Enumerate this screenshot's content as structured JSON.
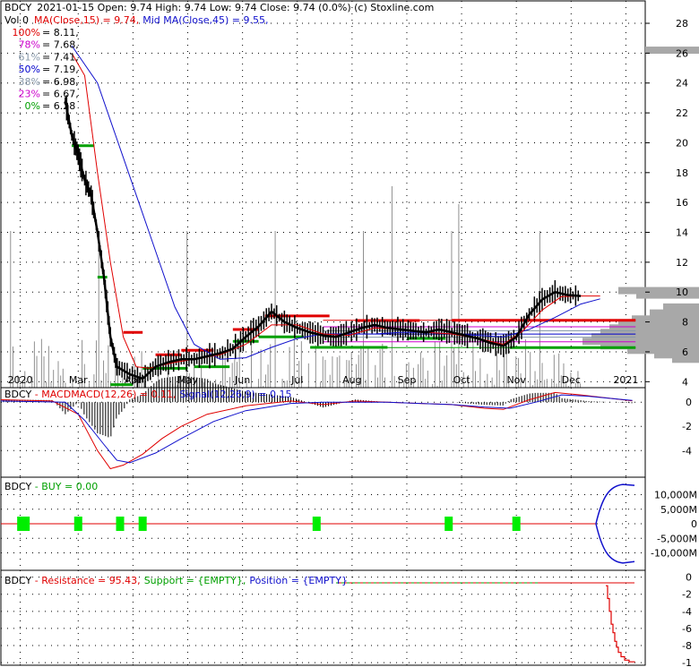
{
  "header": {
    "ticker": "BDCY",
    "quote": "2021-01-15 Open: 9.74  High: 9.74  Low: 9.74  Close: 9.74 (0.0%)  (c) Stoxline.com",
    "vol": "Vol 0",
    "ma": "MA(Close,15) = 9.74,",
    "midma": "Mid MA(Close,45) = 9.55,"
  },
  "fib": [
    {
      "pct": "100%",
      "val": "= 8.11,",
      "color": "#e00000"
    },
    {
      "pct": "78%",
      "val": "= 7.68,",
      "color": "#cc00cc"
    },
    {
      "pct": "61%",
      "val": "= 7.41,",
      "color": "#8899aa"
    },
    {
      "pct": "50%",
      "val": "= 7.19,",
      "color": "#0000cc"
    },
    {
      "pct": "38%",
      "val": "= 6.98,",
      "color": "#8899aa"
    },
    {
      "pct": "23%",
      "val": "= 6.67,",
      "color": "#cc00cc"
    },
    {
      "pct": "0%",
      "val": "= 6.28",
      "color": "#00a000"
    }
  ],
  "panels": {
    "macd": {
      "ticker": "BDCY",
      "name": "MACD",
      "label": "MACD(12,26) = 0.11,",
      "signal": "Signal(12,26,9) = 0.15"
    },
    "buy": {
      "ticker": "BDCY",
      "label": "BUY = 0.00"
    },
    "res": {
      "ticker": "BDCY",
      "resistance": "Resistance = 95.43,",
      "support": "Support = {EMPTY},",
      "position": "Position = {EMPTY}"
    }
  },
  "colors": {
    "red": "#e00000",
    "blue": "#1010cc",
    "green": "#00a000",
    "bright_green": "#00ee00",
    "gray": "#909090"
  },
  "chart_data": [
    {
      "type": "line",
      "title": "BDCY",
      "x_labels": [
        "2020",
        "Mar",
        "Apr",
        "May",
        "Jun",
        "Jul",
        "Aug",
        "Sep",
        "Oct",
        "Nov",
        "Dec",
        "2021"
      ],
      "y_ticks": [
        "4",
        "6",
        "8",
        "10",
        "12",
        "14",
        "16",
        "18",
        "20",
        "22",
        "24",
        "26",
        "28"
      ],
      "ylim": [
        3.3,
        29.5
      ],
      "price": [
        [
          0.1,
          22.8
        ],
        [
          0.11,
          20.5
        ],
        [
          0.12,
          19.2
        ],
        [
          0.13,
          17.5
        ],
        [
          0.14,
          16.5
        ],
        [
          0.15,
          14
        ],
        [
          0.16,
          11
        ],
        [
          0.17,
          7
        ],
        [
          0.18,
          5
        ],
        [
          0.2,
          4.5
        ],
        [
          0.22,
          4.2
        ],
        [
          0.24,
          5
        ],
        [
          0.26,
          5.3
        ],
        [
          0.28,
          5.5
        ],
        [
          0.3,
          5.5
        ],
        [
          0.32,
          5.7
        ],
        [
          0.34,
          5.9
        ],
        [
          0.36,
          6.2
        ],
        [
          0.38,
          7
        ],
        [
          0.4,
          7.7
        ],
        [
          0.42,
          8.7
        ],
        [
          0.44,
          8
        ],
        [
          0.46,
          7.6
        ],
        [
          0.48,
          7.3
        ],
        [
          0.5,
          7.1
        ],
        [
          0.52,
          7
        ],
        [
          0.54,
          7.3
        ],
        [
          0.56,
          7.6
        ],
        [
          0.58,
          7.8
        ],
        [
          0.6,
          7.6
        ],
        [
          0.62,
          7.5
        ],
        [
          0.64,
          7.4
        ],
        [
          0.66,
          7.3
        ],
        [
          0.68,
          7.5
        ],
        [
          0.7,
          7.3
        ],
        [
          0.72,
          7.1
        ],
        [
          0.74,
          6.9
        ],
        [
          0.76,
          6.6
        ],
        [
          0.78,
          6.4
        ],
        [
          0.8,
          7
        ],
        [
          0.82,
          8.5
        ],
        [
          0.84,
          9.5
        ],
        [
          0.86,
          10
        ],
        [
          0.88,
          9.8
        ],
        [
          0.9,
          9.74
        ]
      ],
      "ma15": [
        [
          0.11,
          26
        ],
        [
          0.13,
          24.5
        ],
        [
          0.15,
          18
        ],
        [
          0.17,
          12
        ],
        [
          0.19,
          7
        ],
        [
          0.21,
          5
        ],
        [
          0.23,
          4.9
        ],
        [
          0.27,
          5.3
        ],
        [
          0.3,
          5.5
        ],
        [
          0.34,
          5.8
        ],
        [
          0.38,
          6.5
        ],
        [
          0.42,
          7.8
        ],
        [
          0.46,
          7.8
        ],
        [
          0.5,
          7.2
        ],
        [
          0.54,
          7.1
        ],
        [
          0.58,
          7.6
        ],
        [
          0.62,
          7.5
        ],
        [
          0.66,
          7.3
        ],
        [
          0.7,
          7.2
        ],
        [
          0.74,
          6.9
        ],
        [
          0.78,
          6.5
        ],
        [
          0.81,
          7.4
        ],
        [
          0.84,
          8.8
        ],
        [
          0.87,
          9.7
        ],
        [
          0.9,
          9.74
        ],
        [
          0.93,
          9.74
        ]
      ],
      "ma45": [
        [
          0.11,
          26.5
        ],
        [
          0.15,
          24
        ],
        [
          0.19,
          19
        ],
        [
          0.23,
          14
        ],
        [
          0.27,
          9
        ],
        [
          0.3,
          6.5
        ],
        [
          0.34,
          5.5
        ],
        [
          0.38,
          5.6
        ],
        [
          0.42,
          6.3
        ],
        [
          0.46,
          6.9
        ],
        [
          0.5,
          7.2
        ],
        [
          0.54,
          7.2
        ],
        [
          0.58,
          7.2
        ],
        [
          0.62,
          7.3
        ],
        [
          0.66,
          7.3
        ],
        [
          0.7,
          7.2
        ],
        [
          0.74,
          7.1
        ],
        [
          0.78,
          7
        ],
        [
          0.82,
          7.5
        ],
        [
          0.86,
          8.3
        ],
        [
          0.9,
          9.2
        ],
        [
          0.93,
          9.55
        ]
      ]
    },
    {
      "type": "line",
      "title": "MACD",
      "y_ticks": [
        "0",
        "-2",
        "-4"
      ],
      "ylim": [
        -6.2,
        1.2
      ],
      "macd": [
        [
          0.0,
          0.2
        ],
        [
          0.08,
          0.1
        ],
        [
          0.12,
          -1
        ],
        [
          0.15,
          -4
        ],
        [
          0.17,
          -5.5
        ],
        [
          0.19,
          -5.2
        ],
        [
          0.22,
          -4.3
        ],
        [
          0.25,
          -3
        ],
        [
          0.28,
          -2
        ],
        [
          0.32,
          -1
        ],
        [
          0.38,
          -0.3
        ],
        [
          0.45,
          0.1
        ],
        [
          0.5,
          -0.2
        ],
        [
          0.55,
          0.1
        ],
        [
          0.6,
          0
        ],
        [
          0.65,
          -0.1
        ],
        [
          0.7,
          -0.2
        ],
        [
          0.75,
          -0.5
        ],
        [
          0.78,
          -0.6
        ],
        [
          0.82,
          0.2
        ],
        [
          0.86,
          0.8
        ],
        [
          0.9,
          0.6
        ],
        [
          0.95,
          0.3
        ],
        [
          0.98,
          0.11
        ]
      ],
      "signal": [
        [
          0.0,
          0.1
        ],
        [
          0.1,
          0
        ],
        [
          0.13,
          -1.5
        ],
        [
          0.16,
          -3.5
        ],
        [
          0.18,
          -4.8
        ],
        [
          0.2,
          -5
        ],
        [
          0.24,
          -4.2
        ],
        [
          0.28,
          -3
        ],
        [
          0.33,
          -1.6
        ],
        [
          0.38,
          -0.7
        ],
        [
          0.45,
          -0.1
        ],
        [
          0.5,
          0
        ],
        [
          0.55,
          0
        ],
        [
          0.6,
          0
        ],
        [
          0.65,
          -0.1
        ],
        [
          0.7,
          -0.2
        ],
        [
          0.75,
          -0.4
        ],
        [
          0.79,
          -0.5
        ],
        [
          0.83,
          0
        ],
        [
          0.87,
          0.6
        ],
        [
          0.91,
          0.5
        ],
        [
          0.95,
          0.3
        ],
        [
          0.98,
          0.15
        ]
      ]
    },
    {
      "type": "line",
      "title": "BUY",
      "y_ticks": [
        "10,000M",
        "5,000M",
        "0",
        "-5,000M",
        "-10,000M"
      ],
      "ylim": [
        -16000,
        16000
      ],
      "buy_signals": [
        0.035,
        0.12,
        0.185,
        0.22,
        0.49,
        0.695,
        0.8
      ]
    },
    {
      "type": "line",
      "title": "Resistance",
      "y_ticks": [
        "0",
        "-2",
        "-4",
        "-6",
        "-8",
        "-1"
      ],
      "ylim": [
        -10.3,
        0.8
      ]
    }
  ]
}
